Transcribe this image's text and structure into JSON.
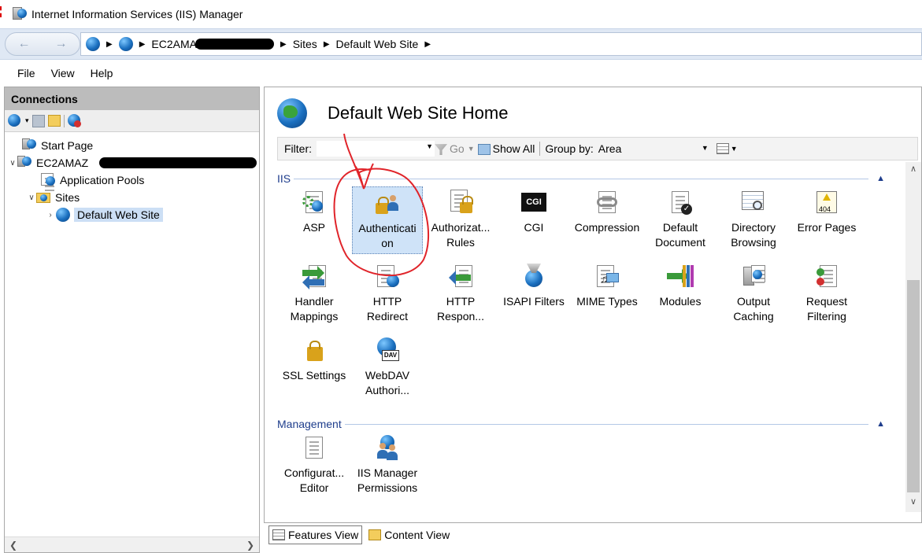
{
  "window": {
    "title": "Internet Information Services (IIS) Manager"
  },
  "address": {
    "crumbs": [
      "EC2AMA",
      "Sites",
      "Default Web Site"
    ]
  },
  "menu": {
    "items": [
      "File",
      "View",
      "Help"
    ]
  },
  "connections": {
    "header": "Connections",
    "tree": {
      "start_page": "Start Page",
      "server": "EC2AMAZ",
      "app_pools": "Application Pools",
      "sites": "Sites",
      "default_site": "Default Web Site"
    }
  },
  "main": {
    "title": "Default Web Site Home",
    "filter": {
      "label": "Filter:",
      "value": "",
      "go": "Go",
      "show_all": "Show All",
      "group_by_label": "Group by:",
      "group_by_value": "Area"
    },
    "sections": [
      {
        "name": "IIS"
      },
      {
        "name": "Management"
      }
    ],
    "iis_features": [
      {
        "line1": "ASP",
        "line2": "",
        "icon": "asp-icon"
      },
      {
        "line1": "Authenticati",
        "line2": "on",
        "icon": "authentication-icon",
        "selected": true
      },
      {
        "line1": "Authorizat...",
        "line2": "Rules",
        "icon": "authorization-rules-icon"
      },
      {
        "line1": "CGI",
        "line2": "",
        "icon": "cgi-icon"
      },
      {
        "line1": "Compression",
        "line2": "",
        "icon": "compression-icon"
      },
      {
        "line1": "Default",
        "line2": "Document",
        "icon": "default-document-icon"
      },
      {
        "line1": "Directory",
        "line2": "Browsing",
        "icon": "directory-browsing-icon"
      },
      {
        "line1": "Error Pages",
        "line2": "",
        "icon": "error-pages-icon"
      },
      {
        "line1": "Handler",
        "line2": "Mappings",
        "icon": "handler-mappings-icon"
      },
      {
        "line1": "HTTP",
        "line2": "Redirect",
        "icon": "http-redirect-icon"
      },
      {
        "line1": "HTTP",
        "line2": "Respon...",
        "icon": "http-response-icon"
      },
      {
        "line1": "ISAPI Filters",
        "line2": "",
        "icon": "isapi-filters-icon"
      },
      {
        "line1": "MIME Types",
        "line2": "",
        "icon": "mime-types-icon"
      },
      {
        "line1": "Modules",
        "line2": "",
        "icon": "modules-icon"
      },
      {
        "line1": "Output",
        "line2": "Caching",
        "icon": "output-caching-icon"
      },
      {
        "line1": "Request",
        "line2": "Filtering",
        "icon": "request-filtering-icon"
      },
      {
        "line1": "SSL Settings",
        "line2": "",
        "icon": "ssl-settings-icon"
      },
      {
        "line1": "WebDAV",
        "line2": "Authori...",
        "icon": "webdav-icon"
      }
    ],
    "management_features": [
      {
        "line1": "Configurat...",
        "line2": "Editor",
        "icon": "configuration-editor-icon"
      },
      {
        "line1": "IIS Manager",
        "line2": "Permissions",
        "icon": "iis-manager-permissions-icon"
      }
    ],
    "icon_text": {
      "cgi": "CGI",
      "error": "404",
      "dav": "DAV"
    }
  },
  "view_tabs": {
    "features": "Features View",
    "content": "Content View"
  },
  "colors": {
    "annotation": "#e0242a",
    "section_text": "#1e3d8c",
    "selection": "#cfe3f8"
  }
}
